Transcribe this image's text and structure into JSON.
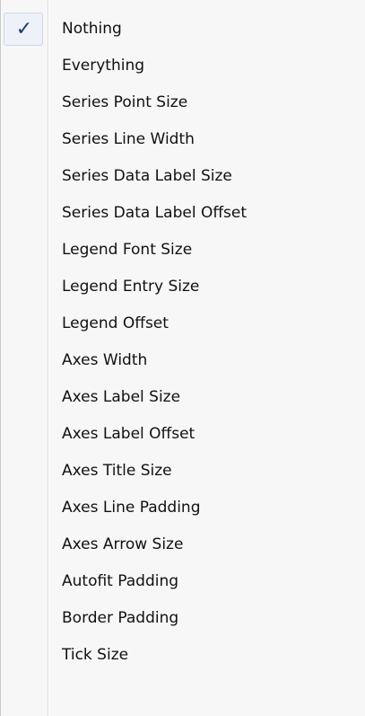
{
  "menu": {
    "items": [
      {
        "label": "Nothing",
        "checked": true
      },
      {
        "label": "Everything",
        "checked": false
      },
      {
        "label": "Series Point Size",
        "checked": false
      },
      {
        "label": "Series Line Width",
        "checked": false
      },
      {
        "label": "Series Data Label Size",
        "checked": false
      },
      {
        "label": "Series Data Label Offset",
        "checked": false
      },
      {
        "label": "Legend Font Size",
        "checked": false
      },
      {
        "label": "Legend Entry Size",
        "checked": false
      },
      {
        "label": "Legend Offset",
        "checked": false
      },
      {
        "label": "Axes Width",
        "checked": false
      },
      {
        "label": "Axes Label Size",
        "checked": false
      },
      {
        "label": "Axes Label Offset",
        "checked": false
      },
      {
        "label": "Axes Title Size",
        "checked": false
      },
      {
        "label": "Axes Line Padding",
        "checked": false
      },
      {
        "label": "Axes Arrow Size",
        "checked": false
      },
      {
        "label": "Autofit Padding",
        "checked": false
      },
      {
        "label": "Border Padding",
        "checked": false
      },
      {
        "label": "Tick Size",
        "checked": false
      }
    ],
    "check_glyph": "✓",
    "check_icon": "checkmark-icon"
  }
}
